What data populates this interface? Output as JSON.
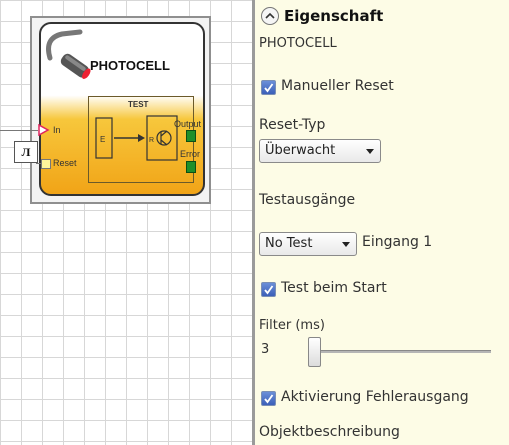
{
  "block": {
    "title": "PHOTOCELL",
    "test_title": "TEST",
    "inputs": [
      "In",
      "Reset"
    ],
    "outputs": [
      "Output",
      "Error"
    ],
    "inner_e": "E",
    "inner_r": "R",
    "pulse_symbol": "Л"
  },
  "panel": {
    "header": "Eigenschaft",
    "object_name": "PHOTOCELL",
    "manual_reset": {
      "label": "Manueller Reset",
      "checked": true
    },
    "reset_type": {
      "label": "Reset-Typ",
      "value": "Überwacht"
    },
    "test_outputs": {
      "label": "Testausgänge",
      "value": "No Test",
      "extra": "Eingang 1"
    },
    "test_at_start": {
      "label": "Test beim Start",
      "checked": true
    },
    "filter": {
      "label": "Filter (ms)",
      "value": "3"
    },
    "error_output": {
      "label": "Aktivierung Fehlerausgang",
      "checked": true
    },
    "object_description": "Objektbeschreibung"
  },
  "colors": {
    "panel_bg": "#fdfce6",
    "block_orange": "#f1a417",
    "pin_green": "#1f8f2a",
    "checkbox_blue": "#3b5fb8"
  }
}
